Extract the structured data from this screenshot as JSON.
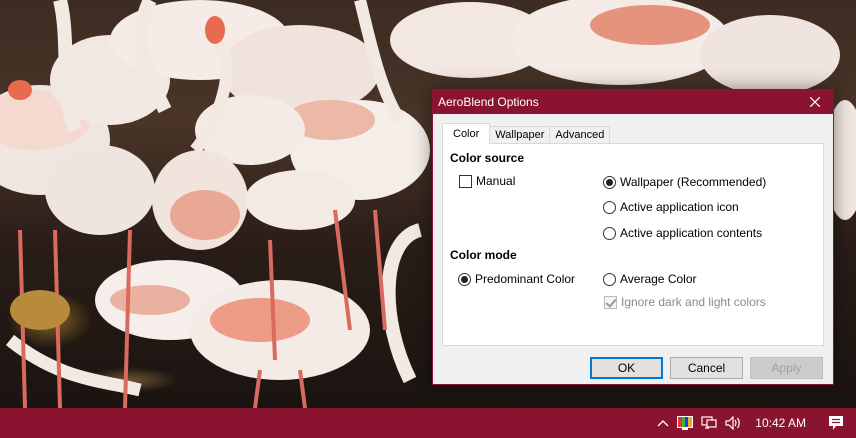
{
  "dialog": {
    "title": "AeroBlend Options",
    "tabs": [
      "Color",
      "Wallpaper",
      "Advanced"
    ],
    "color_tab": {
      "color_source_heading": "Color source",
      "manual_label": "Manual",
      "manual_checked": false,
      "source_options": [
        {
          "label": "Wallpaper (Recommended)",
          "selected": true
        },
        {
          "label": "Active application icon",
          "selected": false
        },
        {
          "label": "Active application contents",
          "selected": false
        }
      ],
      "color_mode_heading": "Color mode",
      "mode_options": [
        {
          "label": "Predominant Color",
          "selected": true
        },
        {
          "label": "Average Color",
          "selected": false
        }
      ],
      "ignore_label": "Ignore dark and light colors",
      "ignore_checked": true,
      "ignore_enabled": false
    },
    "buttons": {
      "ok": "OK",
      "cancel": "Cancel",
      "apply": "Apply"
    }
  },
  "taskbar": {
    "time": "10:42 AM",
    "tray_icons": [
      "chevron-up-icon",
      "color-palette-icon",
      "network-icon",
      "volume-icon"
    ],
    "notification_icon": "action-center-icon"
  },
  "colors": {
    "accent": "#8a1430",
    "default_button_border": "#0078d7",
    "dialog_background": "#f0f0f0"
  }
}
